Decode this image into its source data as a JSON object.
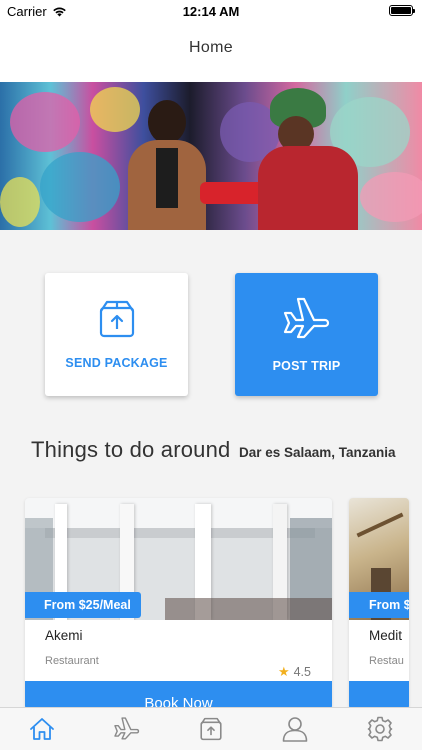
{
  "status_bar": {
    "carrier": "Carrier",
    "time": "12:14 AM"
  },
  "nav": {
    "title": "Home"
  },
  "actions": {
    "send_package": {
      "label": "SEND PACKAGE",
      "icon": "package-upload-icon"
    },
    "post_trip": {
      "label": "POST TRIP",
      "icon": "airplane-icon"
    }
  },
  "section": {
    "lead": "Things to do around",
    "place": "Dar es Salaam, Tanzania"
  },
  "places": [
    {
      "price": "From $25/Meal",
      "name": "Akemi",
      "category": "Restaurant",
      "rating": "4.5",
      "button": "Book Now"
    },
    {
      "price": "From $",
      "name": "Medit",
      "category": "Restau"
    }
  ],
  "tabs": [
    {
      "name": "home",
      "icon": "home-icon",
      "active": true
    },
    {
      "name": "trips",
      "icon": "airplane-icon"
    },
    {
      "name": "packages",
      "icon": "package-icon"
    },
    {
      "name": "profile",
      "icon": "user-icon"
    },
    {
      "name": "settings",
      "icon": "gear-icon"
    }
  ],
  "colors": {
    "accent": "#2d8ef0",
    "inactive_icon": "#8a8a8a"
  }
}
